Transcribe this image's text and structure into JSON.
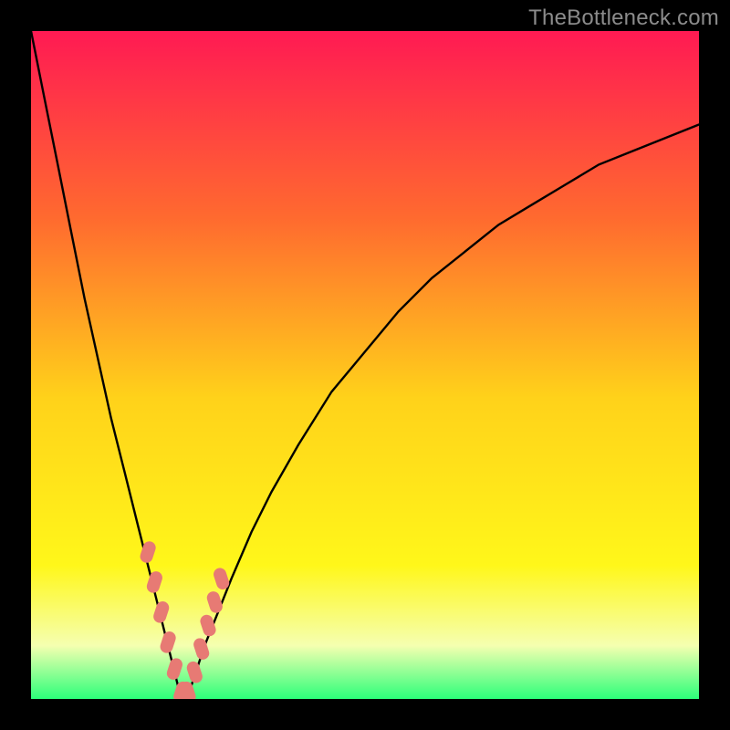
{
  "watermark": "TheBottleneck.com",
  "colors": {
    "frame": "#000000",
    "gradient_top": "#ff1a53",
    "gradient_mid_upper": "#ff6a2f",
    "gradient_mid": "#ffd21a",
    "gradient_lower": "#fff71a",
    "gradient_pale": "#f5ffb0",
    "gradient_bottom": "#2cff7a",
    "curve": "#000000",
    "marker": "#e77a74"
  },
  "chart_data": {
    "type": "line",
    "title": "",
    "xlabel": "",
    "ylabel": "",
    "xlim": [
      0,
      100
    ],
    "ylim": [
      0,
      100
    ],
    "series": [
      {
        "name": "bottleneck-curve",
        "x": [
          0,
          2,
          4,
          6,
          8,
          10,
          12,
          14,
          16,
          18,
          19,
          20,
          21,
          22,
          23,
          24,
          25,
          26,
          28,
          30,
          33,
          36,
          40,
          45,
          50,
          55,
          60,
          65,
          70,
          75,
          80,
          85,
          90,
          95,
          100
        ],
        "y": [
          100,
          90,
          80,
          70,
          60,
          51,
          42,
          34,
          26,
          18,
          14,
          10,
          6,
          2,
          0,
          2,
          5,
          8,
          13,
          18,
          25,
          31,
          38,
          46,
          52,
          58,
          63,
          67,
          71,
          74,
          77,
          80,
          82,
          84,
          86
        ]
      }
    ],
    "markers": {
      "name": "highlight-points",
      "x": [
        17.5,
        18.5,
        19.5,
        20.5,
        21.5,
        22.5,
        23.5,
        24.5,
        25.5,
        26.5,
        27.5,
        28.5
      ],
      "y": [
        22,
        17.5,
        13,
        8.5,
        4.5,
        1,
        1,
        4,
        7.5,
        11,
        14.5,
        18
      ]
    }
  }
}
